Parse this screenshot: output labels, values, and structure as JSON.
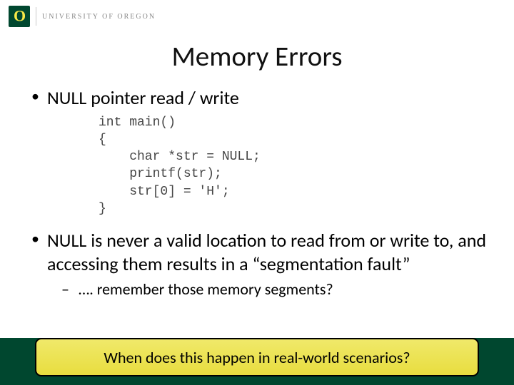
{
  "header": {
    "university_label": "UNIVERSITY OF OREGON"
  },
  "title": "Memory Errors",
  "bullets": {
    "b1": "NULL pointer read / write",
    "b2": "NULL is never a valid location to read from or write to, and accessing them results in a “segmentation fault”",
    "sub1": "…. remember those memory segments?"
  },
  "code": "int main()\n{\n    char *str = NULL;\n    printf(str);\n    str[0] = 'H';\n}",
  "callout": "When does this happen in real-world scenarios?"
}
